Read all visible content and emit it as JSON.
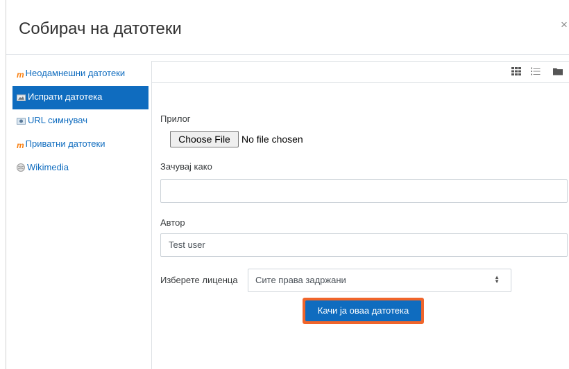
{
  "dialog": {
    "title": "Собирач на датотеки",
    "close_label": "×"
  },
  "sidebar": {
    "items": [
      {
        "label": "Неодамнешни датотеки",
        "icon": "moodle-icon"
      },
      {
        "label": "Испрати датотека",
        "icon": "upload-icon",
        "active": true
      },
      {
        "label": "URL симнувач",
        "icon": "url-download-icon"
      },
      {
        "label": "Приватни датотеки",
        "icon": "moodle-icon"
      },
      {
        "label": "Wikimedia",
        "icon": "wikimedia-icon"
      }
    ]
  },
  "toolbar": {
    "icons": [
      "grid-view-icon",
      "list-view-icon",
      "folder-view-icon"
    ]
  },
  "form": {
    "attachment_label": "Прилог",
    "choose_file_label": "Choose File",
    "file_status": "No file chosen",
    "save_as_label": "Зачувај како",
    "save_as_value": "",
    "author_label": "Автор",
    "author_value": "Test user",
    "license_label": "Изберете лиценца",
    "license_value": "Сите права задржани",
    "upload_label": "Качи ја оваа датотека"
  },
  "colors": {
    "accent": "#0f6cbf",
    "highlight": "#f0652b"
  }
}
